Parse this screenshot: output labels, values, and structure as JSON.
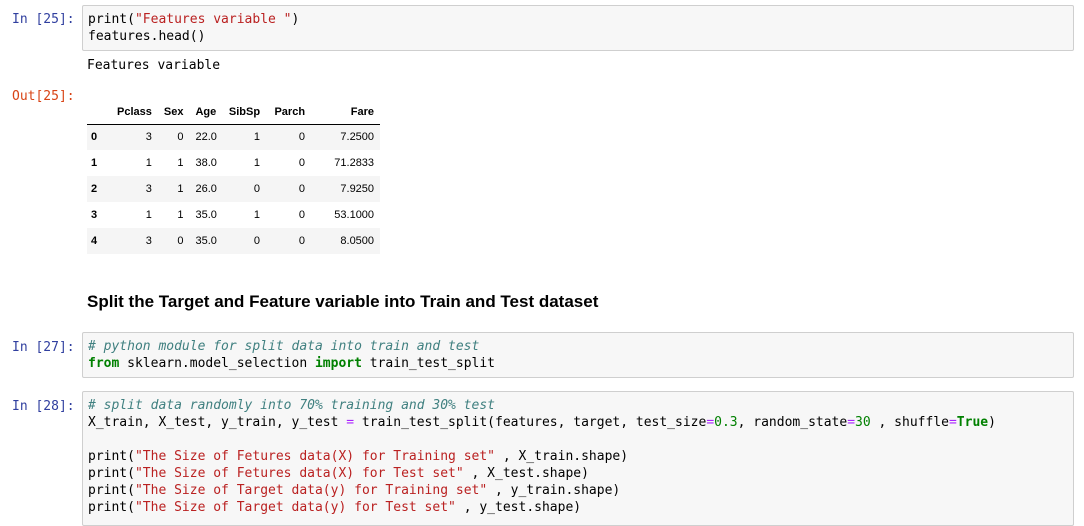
{
  "cells": {
    "c25": {
      "in_prompt": "In [25]:",
      "out_prompt": "Out[25]:",
      "code": [
        "print(",
        "\"Features variable \"",
        ")",
        "features.head()"
      ],
      "stdout": "Features variable"
    },
    "c27": {
      "in_prompt": "In [27]:",
      "comment": "# python module for split data into train and test",
      "kw_from": "from",
      "module": " sklearn.model_selection ",
      "kw_import": "import",
      "name": " train_test_split"
    },
    "c28": {
      "in_prompt": "In [28]:",
      "comment": "# split data randomly into 70% training and 30% test",
      "line2": {
        "a": "X_train, X_test, y_train, y_test ",
        "eq": "=",
        "b": " train_test_split(features, target, test_size",
        "eq2": "=",
        "n1": "0.3",
        "c": ", random_state",
        "eq3": "=",
        "n2": "30",
        "d": " , shuffle",
        "eq4": "=",
        "kw_true": "True",
        "e": ")"
      },
      "prints": [
        {
          "fn": "print(",
          "str": "\"The Size of Fetures data(X) for Training set\"",
          "rest": " , X_train.shape)"
        },
        {
          "fn": "print(",
          "str": "\"The Size of Fetures data(X) for Test set\"",
          "rest": " , X_test.shape)"
        },
        {
          "fn": "print(",
          "str": "\"The Size of Target data(y) for Training set\"",
          "rest": " , y_train.shape)"
        },
        {
          "fn": "print(",
          "str": "\"The Size of Target data(y) for Test set\"",
          "rest": " , y_test.shape)"
        }
      ]
    }
  },
  "dataframe": {
    "columns": [
      "",
      "Pclass",
      "Sex",
      "Age",
      "SibSp",
      "Parch",
      "Fare"
    ],
    "rows": [
      [
        "0",
        "3",
        "0",
        "22.0",
        "1",
        "0",
        "7.2500"
      ],
      [
        "1",
        "1",
        "1",
        "38.0",
        "1",
        "0",
        "71.2833"
      ],
      [
        "2",
        "3",
        "1",
        "26.0",
        "0",
        "0",
        "7.9250"
      ],
      [
        "3",
        "1",
        "1",
        "35.0",
        "1",
        "0",
        "53.1000"
      ],
      [
        "4",
        "3",
        "0",
        "35.0",
        "0",
        "0",
        "8.0500"
      ]
    ]
  },
  "markdown_heading": "Split the Target and Feature variable into Train and Test dataset"
}
